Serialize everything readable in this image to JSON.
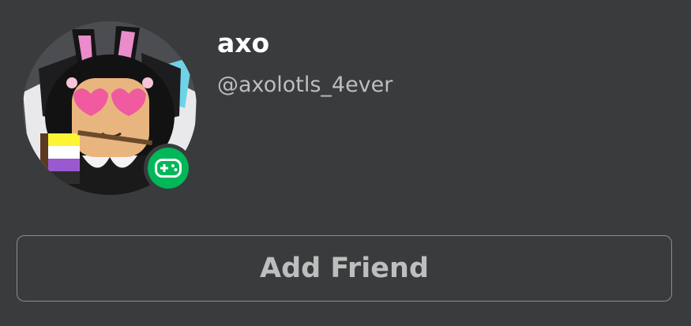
{
  "profile": {
    "display_name": "axo",
    "username": "@axolotls_4ever",
    "avatar_icon": "avatar-image",
    "presence": {
      "status": "in-game",
      "icon": "gamepad-icon",
      "color": "#02b757"
    }
  },
  "actions": {
    "add_friend_label": "Add Friend"
  },
  "colors": {
    "background": "#393b3d",
    "primary_text": "#ffffff",
    "secondary_text": "#bdbebe",
    "button_border": "#8a8c8e"
  }
}
